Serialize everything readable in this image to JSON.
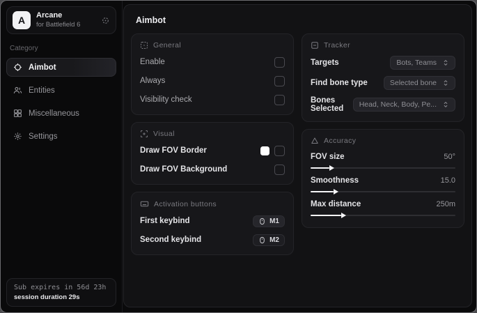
{
  "sidebar": {
    "logo": {
      "letter": "A",
      "title": "Arcane",
      "subtitle": "for Battlefield 6"
    },
    "category_label": "Category",
    "items": [
      {
        "label": "Aimbot"
      },
      {
        "label": "Entities"
      },
      {
        "label": "Miscellaneous"
      },
      {
        "label": "Settings"
      }
    ],
    "subscription": {
      "line1": "Sub expires in 56d 23h",
      "line2": "session duration 29s"
    }
  },
  "main": {
    "title": "Aimbot",
    "general": {
      "header": "General",
      "rows": [
        {
          "label": "Enable",
          "checked": false
        },
        {
          "label": "Always",
          "checked": false
        },
        {
          "label": "Visibility check",
          "checked": false
        }
      ]
    },
    "visual": {
      "header": "Visual",
      "rows": [
        {
          "label": "Draw FOV Border",
          "swatch": "#ffffff",
          "checked": false
        },
        {
          "label": "Draw FOV Background",
          "checked": false
        }
      ]
    },
    "activation": {
      "header": "Activation buttons",
      "rows": [
        {
          "label": "First keybind",
          "key": "M1"
        },
        {
          "label": "Second keybind",
          "key": "M2"
        }
      ]
    },
    "tracker": {
      "header": "Tracker",
      "rows": [
        {
          "label": "Targets",
          "value": "Bots, Teams"
        },
        {
          "label": "Find bone type",
          "value": "Selected bone"
        },
        {
          "label": "Bones Selected",
          "value": "Head, Neck, Body, Pe..."
        }
      ]
    },
    "accuracy": {
      "header": "Accuracy",
      "rows": [
        {
          "label": "FOV size",
          "value": "50°",
          "fill": "13%"
        },
        {
          "label": "Smoothness",
          "value": "15.0",
          "fill": "16%"
        },
        {
          "label": "Max distance",
          "value": "250m",
          "fill": "21%"
        }
      ]
    }
  },
  "colors": {
    "accent": "#ffffff",
    "card_bg": "#17171a",
    "panel_bg": "#121214",
    "window_bg": "#0a0a0b"
  }
}
